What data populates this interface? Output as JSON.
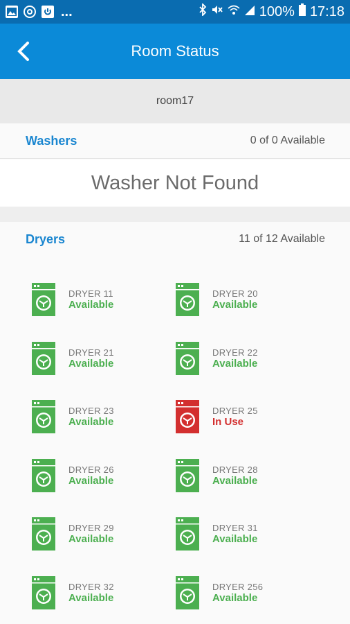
{
  "status_bar": {
    "left_icons": [
      "image-icon",
      "vpn-icon",
      "power-icon"
    ],
    "more": "...",
    "battery": "100%",
    "time": "17:18"
  },
  "app_bar": {
    "title": "Room Status"
  },
  "room": {
    "name": "room17"
  },
  "washers": {
    "label": "Washers",
    "count": "0 of 0 Available",
    "empty_message": "Washer Not Found"
  },
  "dryers": {
    "label": "Dryers",
    "count": "11 of 12 Available",
    "items": [
      {
        "name": "DRYER 11",
        "status": "Available",
        "state": "available"
      },
      {
        "name": "DRYER 20",
        "status": "Available",
        "state": "available"
      },
      {
        "name": "DRYER 21",
        "status": "Available",
        "state": "available"
      },
      {
        "name": "DRYER 22",
        "status": "Available",
        "state": "available"
      },
      {
        "name": "DRYER 23",
        "status": "Available",
        "state": "available"
      },
      {
        "name": "DRYER 25",
        "status": "In Use",
        "state": "in_use"
      },
      {
        "name": "DRYER 26",
        "status": "Available",
        "state": "available"
      },
      {
        "name": "DRYER 28",
        "status": "Available",
        "state": "available"
      },
      {
        "name": "DRYER 29",
        "status": "Available",
        "state": "available"
      },
      {
        "name": "DRYER 31",
        "status": "Available",
        "state": "available"
      },
      {
        "name": "DRYER 32",
        "status": "Available",
        "state": "available"
      },
      {
        "name": "DRYER 256",
        "status": "Available",
        "state": "available"
      }
    ]
  },
  "colors": {
    "status_bar": "#0a6cb0",
    "app_bar": "#0b8ad8",
    "section_label": "#1a86d0",
    "available": "#4caf50",
    "in_use": "#d32f2f"
  }
}
